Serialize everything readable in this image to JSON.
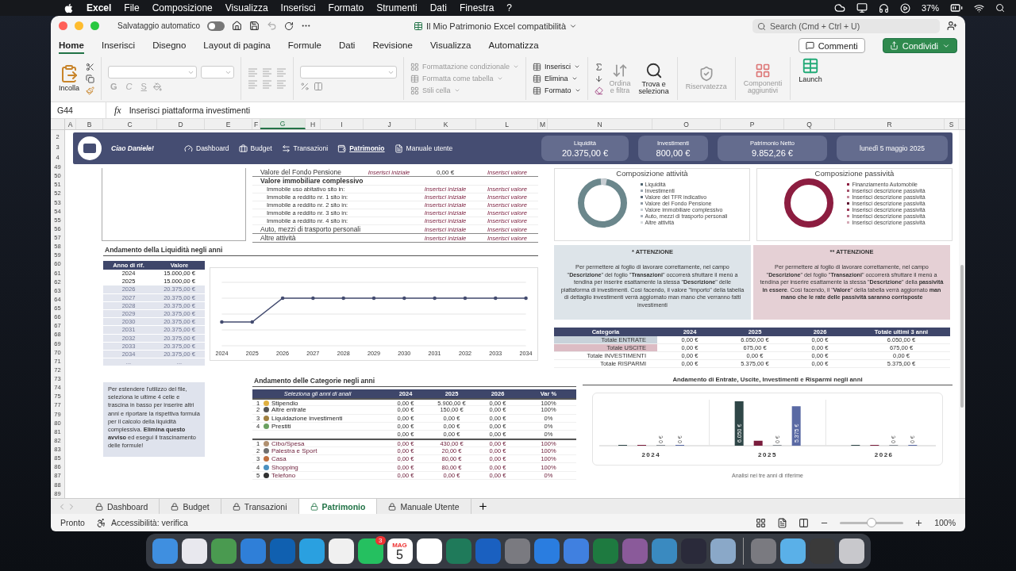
{
  "menu_bar": {
    "items": [
      "Excel",
      "File",
      "Composizione",
      "Visualizza",
      "Inserisci",
      "Formato",
      "Strumenti",
      "Dati",
      "Finestra",
      "?"
    ],
    "battery": "37%"
  },
  "window": {
    "autosave": "Salvataggio automatico",
    "autosave_on": false,
    "title": "Il Mio Patrimonio Excel compatibilità",
    "search": {
      "placeholder": "Search (Cmd + Ctrl + U)"
    }
  },
  "ribbon_tabs": [
    {
      "label": "Home",
      "selected": true
    },
    {
      "label": "Inserisci",
      "selected": false
    },
    {
      "label": "Disegno",
      "selected": false
    },
    {
      "label": "Layout di pagina",
      "selected": false
    },
    {
      "label": "Formule",
      "selected": false
    },
    {
      "label": "Dati",
      "selected": false
    },
    {
      "label": "Revisione",
      "selected": false
    },
    {
      "label": "Visualizza",
      "selected": false
    },
    {
      "label": "Automatizza",
      "selected": false
    }
  ],
  "comments_button": "Commenti",
  "share_button": "Condividi",
  "ribbon": {
    "paste": "Incolla",
    "font_styles": [
      "G",
      "C",
      "S"
    ],
    "conditional": "Formattazione condizionale",
    "format_table": "Formatta come tabella",
    "cell_styles": "Stili cella",
    "insert": "Inserisci",
    "delete": "Elimina",
    "format": "Formato",
    "sort": "Ordina\ne filtra",
    "find": "Trova e\nseleziona",
    "sensitivity": "Riservatezza",
    "addins": "Componenti\naggiuntivi",
    "launch": "Launch"
  },
  "formula_bar": {
    "cell": "G44",
    "fx": "fx",
    "formula": "Inserisci piattaforma investimenti"
  },
  "columns": [
    {
      "label": "A",
      "selected": false
    },
    {
      "label": "B",
      "selected": false
    },
    {
      "label": "C",
      "selected": false
    },
    {
      "label": "D",
      "selected": false
    },
    {
      "label": "E",
      "selected": false
    },
    {
      "label": "F",
      "selected": false
    },
    {
      "label": "G",
      "selected": true
    },
    {
      "label": "H",
      "selected": false
    },
    {
      "label": "I",
      "selected": false
    },
    {
      "label": "J",
      "selected": false
    },
    {
      "label": "K",
      "selected": false
    },
    {
      "label": "L",
      "selected": false
    },
    {
      "label": "M",
      "selected": false
    },
    {
      "label": "N",
      "selected": false
    },
    {
      "label": "O",
      "selected": false
    },
    {
      "label": "P",
      "selected": false
    },
    {
      "label": "Q",
      "selected": false
    },
    {
      "label": "R",
      "selected": false
    },
    {
      "label": "S",
      "selected": false
    }
  ],
  "row_numbers": [
    "2",
    "3",
    "4",
    "49",
    "50",
    "51",
    "52",
    "53",
    "54",
    "55",
    "56",
    "57",
    "58",
    "59",
    "60",
    "61",
    "62",
    "63",
    "64",
    "65",
    "66",
    "67",
    "68",
    "69",
    "70",
    "71",
    "72",
    "73",
    "74",
    "75",
    "77",
    "79",
    "80",
    "81",
    "82",
    "83",
    "85",
    "86",
    "87",
    "88",
    "89"
  ],
  "dashboard_header": {
    "greeting": "Ciao Daniele!",
    "nav": [
      {
        "label": "Dashboard",
        "kind": "gauge",
        "selected": false
      },
      {
        "label": "Budget",
        "kind": "briefcase",
        "selected": false
      },
      {
        "label": "Transazioni",
        "kind": "arrows",
        "selected": false
      },
      {
        "label": "Patrimonio",
        "kind": "wallet",
        "selected": true
      },
      {
        "label": "Manuale utente",
        "kind": "document",
        "selected": false
      }
    ],
    "kpis": [
      {
        "label": "Liquidità",
        "value": "20.375,00 €"
      },
      {
        "label": "Investimenti",
        "value": "800,00 €"
      },
      {
        "label": "Patrimonio Netto",
        "value": "9.852,26 €"
      }
    ],
    "date": "lunedì 5 maggio 2025"
  },
  "assets_table": {
    "rows": [
      {
        "kind": "item",
        "label": "Valore del Fondo Pensione",
        "note": "Inserisci iniziale",
        "initial": "0,00 €",
        "value": "Inserisci valore"
      },
      {
        "kind": "group",
        "label": "Valore immobiliare complessivo"
      },
      {
        "kind": "sub",
        "label": "Immobile uso abitativo sito in:",
        "initial": "Inserisci iniziale",
        "value": "Inserisci valore"
      },
      {
        "kind": "sub",
        "label": "Immobile a reddito nr. 1 sito in:",
        "initial": "Inserisci iniziale",
        "value": "Inserisci valore"
      },
      {
        "kind": "sub",
        "label": "Immobile a reddito nr. 2 sito in:",
        "initial": "Inserisci iniziale",
        "value": "Inserisci valore"
      },
      {
        "kind": "sub",
        "label": "Immobile a reddito nr. 3 sito in:",
        "initial": "Inserisci iniziale",
        "value": "Inserisci valore"
      },
      {
        "kind": "sub",
        "label": "Immobile a reddito nr. 4 sito in:",
        "initial": "Inserisci iniziale",
        "value": "Inserisci valore"
      },
      {
        "kind": "item",
        "label": "Auto, mezzi di trasporto personali",
        "initial": "Inserisci iniziale",
        "value": "Inserisci valore"
      },
      {
        "kind": "item",
        "label": "Altre attività",
        "initial": "Inserisci iniziale",
        "value": "Inserisci valore"
      }
    ]
  },
  "donuts": [
    {
      "title": "Composizione attività",
      "color": "#6b878c",
      "legend": [
        {
          "label": "Liquidità",
          "color": "#4f6470"
        },
        {
          "label": "Investimenti",
          "color": "#9aa6b0"
        },
        {
          "label": "Valore del TFR indicativo",
          "color": "#5e6c7a"
        },
        {
          "label": "Valore del Fondo Pensione",
          "color": "#8f9aa5"
        },
        {
          "label": "Valore immobiliare complessivo",
          "color": "#c5ccd2"
        },
        {
          "label": "Auto, mezzi di trasporto personali",
          "color": "#a9b2ba"
        },
        {
          "label": "Altre attività",
          "color": "#d6dadd"
        }
      ]
    },
    {
      "title": "Composizione passività",
      "color": "#8c1d40",
      "legend": [
        {
          "label": "Finanziamento Automobile",
          "color": "#8c1d40"
        },
        {
          "label": "Inserisci descrizione passività",
          "color": "#a5506a"
        },
        {
          "label": "Inserisci descrizione passività",
          "color": "#c48a9c"
        },
        {
          "label": "Inserisci descrizione passività",
          "color": "#5e1430"
        },
        {
          "label": "Inserisci descrizione passività",
          "color": "#9c3a58"
        },
        {
          "label": "Inserisci descrizione passività",
          "color": "#b87088"
        },
        {
          "label": "Inserisci descrizione passività",
          "color": "#d4aab6"
        }
      ]
    }
  ],
  "liquidity": {
    "title": "Andamento della Liquidità negli anni",
    "columns": [
      "Anno di rif.",
      "Valore"
    ],
    "rows": [
      {
        "year": "2024",
        "value": "15.000,00 €",
        "projected": false
      },
      {
        "year": "2025",
        "value": "15.000,00 €",
        "projected": false
      },
      {
        "year": "2026",
        "value": "20.375,00 €",
        "projected": true
      },
      {
        "year": "2027",
        "value": "20.375,00 €",
        "projected": true
      },
      {
        "year": "2028",
        "value": "20.375,00 €",
        "projected": true
      },
      {
        "year": "2029",
        "value": "20.375,00 €",
        "projected": true
      },
      {
        "year": "2030",
        "value": "20.375,00 €",
        "projected": true
      },
      {
        "year": "2031",
        "value": "20.375,00 €",
        "projected": true
      },
      {
        "year": "2032",
        "value": "20.375,00 €",
        "projected": true
      },
      {
        "year": "2033",
        "value": "20.375,00 €",
        "projected": true
      },
      {
        "year": "2034",
        "value": "20.375,00 €",
        "projected": true
      },
      {
        "year": "...",
        "value": "...",
        "projected": true
      }
    ],
    "chart_x_labels": [
      "2024",
      "2025",
      "2026",
      "2027",
      "2028",
      "2029",
      "2030",
      "2031",
      "2032",
      "2033",
      "2034"
    ]
  },
  "notices": [
    {
      "title": "* ATTENZIONE",
      "color": "#dde4e9",
      "text": "Per permettere al foglio di lavorare correttamente, nel campo \"**Descrizione**\" del foglio \"**Transazioni**\" occorrerà sfruttare il menù a tendina per inserire esattamente la stessa \"**Descrizione**\" delle piattaforma di investimenti. Così facendo, il valore \"Importo\" della tabella di dettaglio investimenti verrà aggiornato man mano che verranno fatti investimenti"
    },
    {
      "title": "** ATTENZIONE",
      "color": "#e5d0d5",
      "text": "Per permettere al foglio di lavorare correttamente, nel campo \"**Descrizione**\" del foglio \"**Transazioni**\" occorrerà sfruttare il menù a tendina per inserire esattamente la stessa \"**Descrizione**\" della **passività in essere**. Così facendo, il \"**Valore**\" della tabella verrà aggiornato **man mano che le rate delle passività saranno corrisposte**"
    }
  ],
  "totals": {
    "columns": [
      "Categoria",
      "2024",
      "2025",
      "2026",
      "Totale ultimi 3 anni"
    ],
    "rows": [
      {
        "color": "#c8d2da",
        "cells": [
          "Totale ENTRATE",
          "0,00 €",
          "6.050,00 €",
          "0,00 €",
          "6.050,00 €"
        ]
      },
      {
        "color": "#dcbcc4",
        "cells": [
          "Totale USCITE",
          "0,00 €",
          "675,00 €",
          "0,00 €",
          "675,00 €"
        ]
      },
      {
        "cells": [
          "Totale INVESTIMENTI",
          "0,00 €",
          "0,00 €",
          "0,00 €",
          "0,00 €"
        ]
      },
      {
        "cells": [
          "Totale RISPARMI",
          "0,00 €",
          "5.375,00 €",
          "0,00 €",
          "5.375,00 €"
        ]
      }
    ]
  },
  "extend_note": "Per estendere l'utilizzo del file, seleziona le ultime 4 celle e trascina in basso per inserire altri anni e riportare la rispettiva formula per il calcolo della liquidità complessiva. **Elimina questo avviso** ed esegui il trascinamento delle formule!",
  "categories": {
    "title": "Andamento delle Categorie negli anni",
    "columns": [
      "Seleziona gli anni di anali",
      "2024",
      "2025",
      "2026",
      "Var %"
    ],
    "groups": [
      {
        "kind": "income",
        "rows": [
          {
            "index": "1",
            "label": "Stipendio",
            "color": "#e0b040",
            "cells": [
              "0,00 €",
              "5.900,00 €",
              "0,00 €",
              "100%"
            ]
          },
          {
            "index": "2",
            "label": "Altre entrate",
            "color": "#555555",
            "cells": [
              "0,00 €",
              "150,00 €",
              "0,00 €",
              "100%"
            ]
          },
          {
            "index": "3",
            "label": "Liquidazione investimenti",
            "color": "#a08040",
            "cells": [
              "0,00 €",
              "0,00 €",
              "0,00 €",
              "0%"
            ]
          },
          {
            "index": "4",
            "label": "Prestiti",
            "color": "#6aa060",
            "cells": [
              "0,00 €",
              "0,00 €",
              "0,00 €",
              "0%"
            ]
          },
          {
            "cells": [
              "0,00 €",
              "0,00 €",
              "0,00 €",
              "0%"
            ]
          }
        ]
      },
      {
        "kind": "expense",
        "rows": [
          {
            "index": "1",
            "label": "Cibo/Spesa",
            "color": "#b09070",
            "cells": [
              "0,00 €",
              "430,00 €",
              "0,00 €",
              "100%"
            ]
          },
          {
            "index": "2",
            "label": "Palestra e Sport",
            "color": "#707070",
            "cells": [
              "0,00 €",
              "20,00 €",
              "0,00 €",
              "100%"
            ]
          },
          {
            "index": "3",
            "label": "Casa",
            "color": "#c07040",
            "cells": [
              "0,00 €",
              "80,00 €",
              "0,00 €",
              "100%"
            ]
          },
          {
            "index": "4",
            "label": "Shopping",
            "color": "#4a90c0",
            "cells": [
              "0,00 €",
              "80,00 €",
              "0,00 €",
              "100%"
            ]
          },
          {
            "index": "5",
            "label": "Telefono",
            "color": "#303030",
            "cells": [
              "0,00 €",
              "0,00 €",
              "0,00 €",
              "0%"
            ]
          }
        ]
      }
    ]
  },
  "bar_chart": {
    "title": "Andamento di Entrate, Uscite, Investimenti e Risparmi negli anni",
    "footer": "Analisi nei tre anni di riferime",
    "chart_data": {
      "type": "bar",
      "categories": [
        "2024",
        "2025",
        "2026"
      ],
      "series": [
        {
          "color": "#2f4647",
          "values": [
            0,
            6050,
            0
          ],
          "value_labels": [
            null,
            "6.050 €",
            null
          ]
        },
        {
          "color": "#7a1d3d",
          "values": [
            0,
            675,
            0
          ],
          "value_labels": [
            null,
            null,
            null
          ]
        },
        {
          "color": "#8a8f96",
          "values": [
            0,
            0,
            0
          ],
          "value_labels": [
            "0 €",
            "0 €",
            "0 €"
          ]
        },
        {
          "color": "#5a6aa4",
          "values": [
            0,
            5375,
            0
          ],
          "value_labels": [
            "0 €",
            "5.375 €",
            "0 €"
          ]
        }
      ]
    }
  },
  "sheet_tabs": [
    {
      "label": "Dashboard",
      "selected": false
    },
    {
      "label": "Budget",
      "selected": false
    },
    {
      "label": "Transazioni",
      "selected": false
    },
    {
      "label": "Patrimonio",
      "selected": true
    },
    {
      "label": "Manuale Utente",
      "selected": false
    }
  ],
  "status": {
    "ready": "Pronto",
    "accessibility": "Accessibilità: verifica",
    "zoom": "100%",
    "level": 0.5
  },
  "dock": [
    {
      "kind": "app",
      "color": "#3f8fe0"
    },
    {
      "kind": "app",
      "color": "#e8e8ee"
    },
    {
      "kind": "app",
      "color": "#4a9a50"
    },
    {
      "kind": "app",
      "color": "#2f7fd8"
    },
    {
      "kind": "app",
      "color": "#1060b0"
    },
    {
      "kind": "app",
      "color": "#2aa0e0"
    },
    {
      "kind": "app",
      "color": "#f0f0f0"
    },
    {
      "kind": "app",
      "color": "#25c060",
      "badge": "3"
    },
    {
      "kind": "calendar",
      "month": "MAG",
      "day": "5"
    },
    {
      "kind": "app",
      "color": "#ffffff"
    },
    {
      "kind": "app",
      "color": "#1f7a5a"
    },
    {
      "kind": "app",
      "color": "#1a60c0"
    },
    {
      "kind": "app",
      "color": "#7a7a80"
    },
    {
      "kind": "app",
      "color": "#2a7de0"
    },
    {
      "kind": "app",
      "color": "#4080e0"
    },
    {
      "kind": "app",
      "color": "#1e7a40"
    },
    {
      "kind": "app",
      "color": "#8a5a9a"
    },
    {
      "kind": "app",
      "color": "#3a8ac0"
    },
    {
      "kind": "app",
      "color": "#2a2a3a"
    },
    {
      "kind": "app",
      "color": "#8aa8c8"
    },
    {
      "kind": "separator"
    },
    {
      "kind": "app",
      "color": "#7a7a80"
    },
    {
      "kind": "app",
      "color": "#5ab0e8"
    },
    {
      "kind": "app",
      "color": "#3a3a3a"
    },
    {
      "kind": "app",
      "color": "#c8c8cc"
    }
  ]
}
